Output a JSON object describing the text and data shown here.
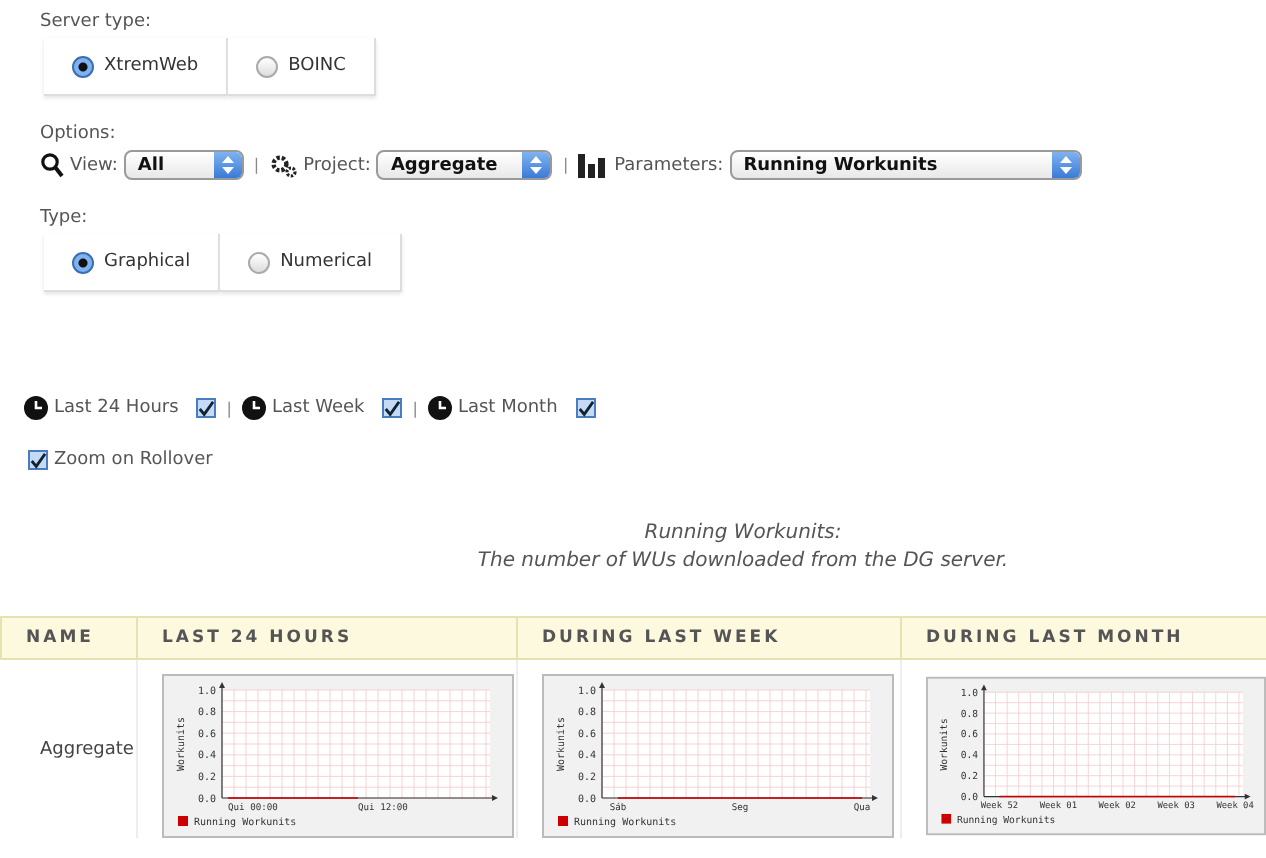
{
  "server_type": {
    "label": "Server type:",
    "options": [
      {
        "label": "XtremWeb",
        "selected": true
      },
      {
        "label": "BOINC",
        "selected": false
      }
    ]
  },
  "options": {
    "label": "Options:",
    "separator": "|",
    "filters": [
      {
        "kind": "view",
        "label": "View:",
        "value": "All"
      },
      {
        "kind": "project",
        "label": "Project:",
        "value": "Aggregate"
      },
      {
        "kind": "parameters",
        "label": "Parameters:",
        "value": "Running Workunits"
      }
    ]
  },
  "type": {
    "label": "Type:",
    "options": [
      {
        "label": "Graphical",
        "selected": true
      },
      {
        "label": "Numerical",
        "selected": false
      }
    ]
  },
  "periods": {
    "separator": "|",
    "items": [
      {
        "label": "Last 24 Hours",
        "checked": true
      },
      {
        "label": "Last Week",
        "checked": true
      },
      {
        "label": "Last Month",
        "checked": true
      }
    ]
  },
  "zoom": {
    "label": "Zoom on Rollover",
    "checked": true
  },
  "title": {
    "heading": "Running Workunits:",
    "subtitle": "The number of WUs downloaded from the DG server."
  },
  "table": {
    "columns": [
      "NAME",
      "LAST 24 HOURS",
      "DURING LAST WEEK",
      "DURING LAST MONTH"
    ],
    "rows": [
      {
        "name": "Aggregate",
        "charts": [
          {
            "chart_data": {
              "type": "line",
              "grid": true,
              "ylabel": "Workunits",
              "categories": [
                "Qui 00:00",
                "Qui 12:00"
              ],
              "ylim": [
                0,
                1
              ],
              "yticks": [
                {
                  "value": 1,
                  "label": "1.0"
                },
                {
                  "value": 0.8,
                  "label": "0.8"
                },
                {
                  "value": 0.6,
                  "label": "0.6"
                },
                {
                  "value": 0.4,
                  "label": "0.4"
                },
                {
                  "value": 0.2,
                  "label": "0.2"
                },
                {
                  "value": 0,
                  "label": "0.0"
                }
              ],
              "series": [
                {
                  "name": "Running Workunits",
                  "color": "#cc0000",
                  "values": [
                    0,
                    0
                  ]
                }
              ]
            }
          },
          {
            "chart_data": {
              "type": "line",
              "grid": true,
              "ylabel": "Workunits",
              "categories": [
                "Sáb",
                "Seg",
                "Qua"
              ],
              "ylim": [
                0,
                1
              ],
              "yticks": [
                {
                  "value": 1,
                  "label": "1.0"
                },
                {
                  "value": 0.8,
                  "label": "0.8"
                },
                {
                  "value": 0.6,
                  "label": "0.6"
                },
                {
                  "value": 0.4,
                  "label": "0.4"
                },
                {
                  "value": 0.2,
                  "label": "0.2"
                },
                {
                  "value": 0,
                  "label": "0.0"
                }
              ],
              "series": [
                {
                  "name": "Running Workunits",
                  "color": "#cc0000",
                  "values": [
                    0,
                    0,
                    0
                  ]
                }
              ]
            }
          },
          {
            "chart_data": {
              "type": "line",
              "grid": true,
              "ylabel": "Workunits",
              "categories": [
                "Week 52",
                "Week 01",
                "Week 02",
                "Week 03",
                "Week 04"
              ],
              "ylim": [
                0,
                1
              ],
              "yticks": [
                {
                  "value": 1,
                  "label": "1.0"
                },
                {
                  "value": 0.8,
                  "label": "0.8"
                },
                {
                  "value": 0.6,
                  "label": "0.6"
                },
                {
                  "value": 0.4,
                  "label": "0.4"
                },
                {
                  "value": 0.2,
                  "label": "0.2"
                },
                {
                  "value": 0,
                  "label": "0.0"
                }
              ],
              "series": [
                {
                  "name": "Running Workunits",
                  "color": "#cc0000",
                  "values": [
                    0,
                    0,
                    0,
                    0,
                    0
                  ]
                }
              ]
            }
          }
        ]
      }
    ]
  }
}
